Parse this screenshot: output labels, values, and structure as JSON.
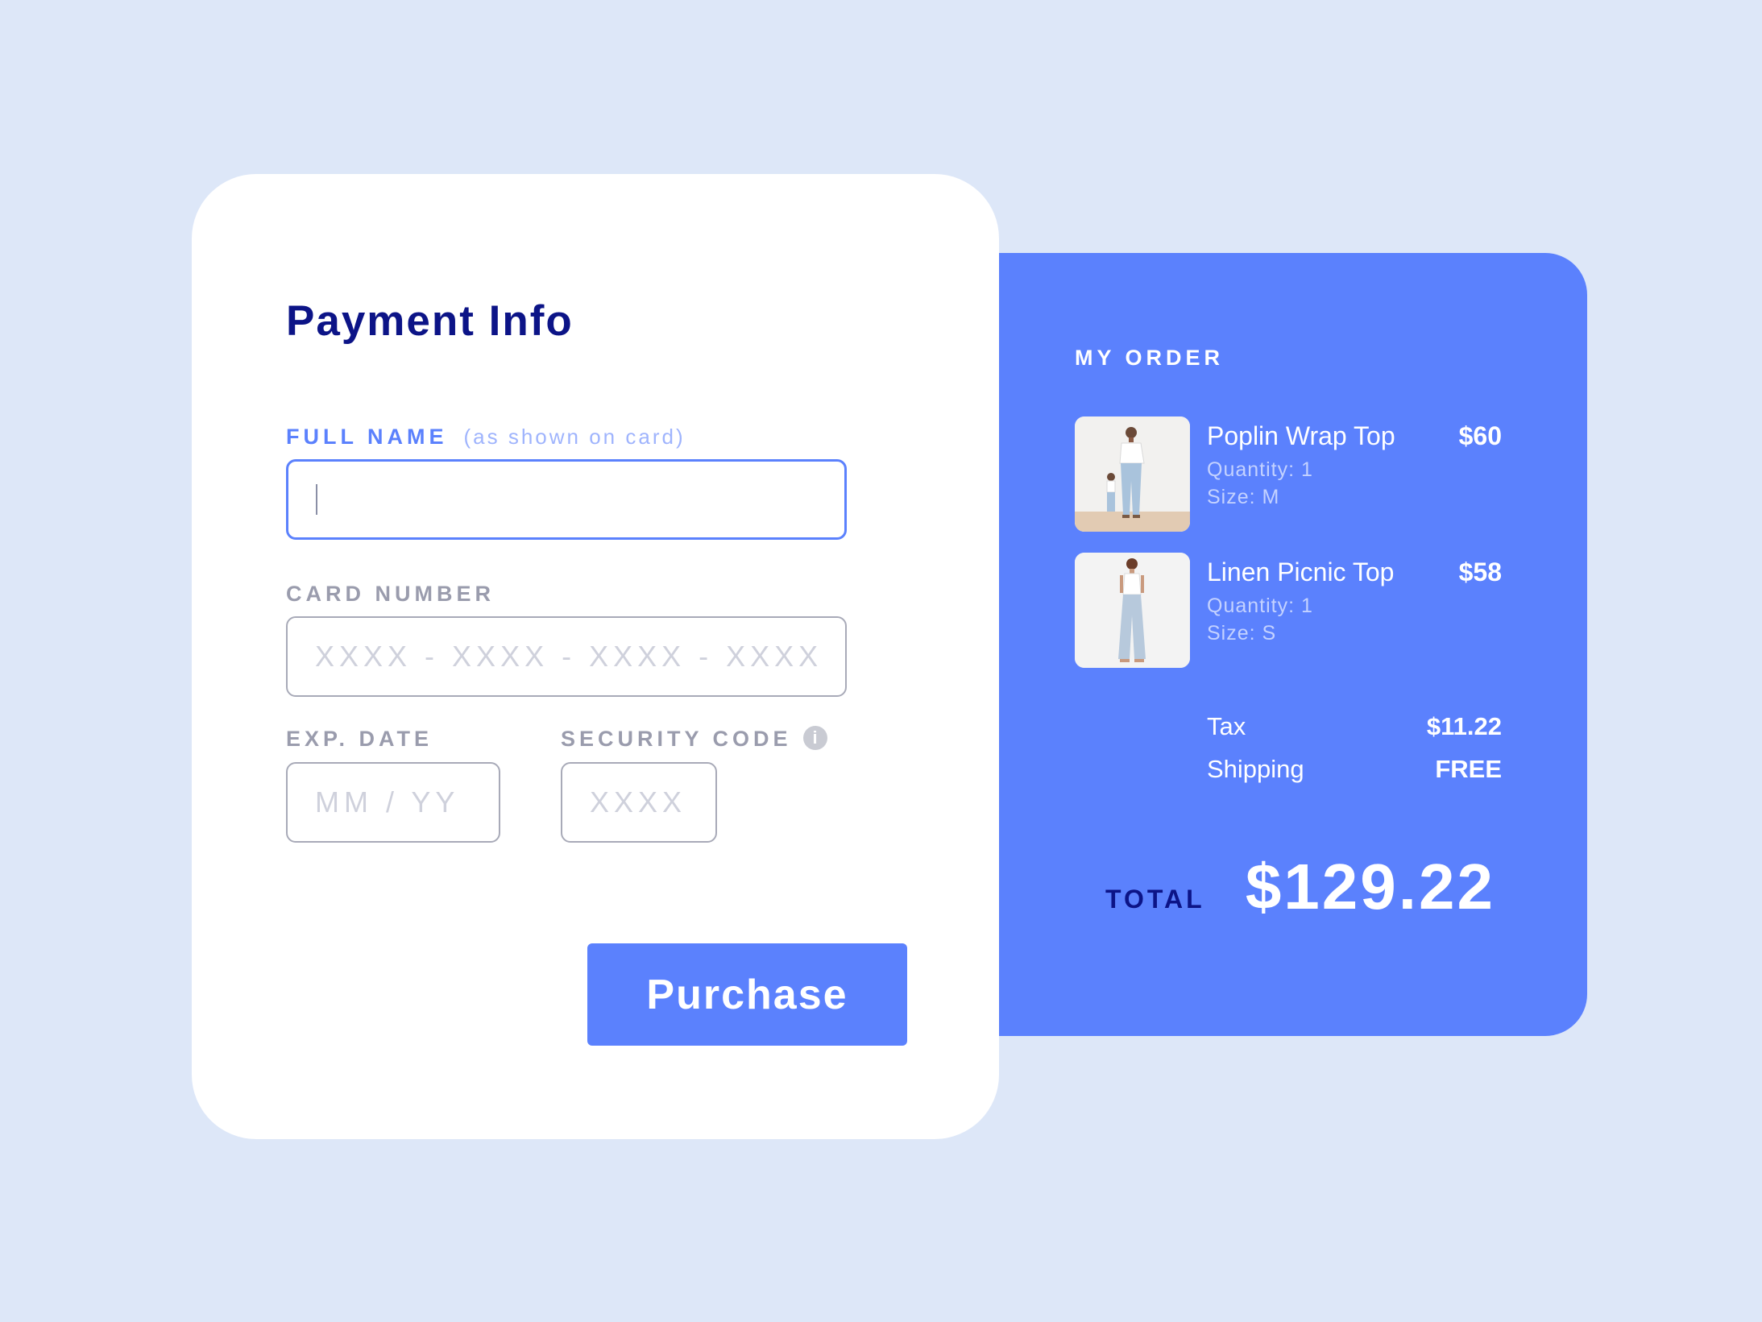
{
  "payment": {
    "title": "Payment Info",
    "full_name": {
      "label": "FULL NAME",
      "hint": "(as shown on card)",
      "value": "",
      "placeholder": ""
    },
    "card_number": {
      "label": "CARD NUMBER",
      "value": "",
      "placeholder": "XXXX - XXXX - XXXX - XXXX"
    },
    "exp_date": {
      "label": "EXP. DATE",
      "value": "",
      "placeholder": "MM / YY"
    },
    "security_code": {
      "label": "SECURITY CODE",
      "value": "",
      "placeholder": "XXXX",
      "info_icon": "info-icon"
    },
    "purchase_label": "Purchase"
  },
  "order": {
    "heading": "MY ORDER",
    "items": [
      {
        "name": "Poplin Wrap Top",
        "price": "$60",
        "quantity": "Quantity: 1",
        "size": "Size: M",
        "image": "product-photo-poplin-wrap-top"
      },
      {
        "name": "Linen Picnic Top",
        "price": "$58",
        "quantity": "Quantity: 1",
        "size": "Size: S",
        "image": "product-photo-linen-picnic-top"
      }
    ],
    "tax": {
      "label": "Tax",
      "value": "$11.22"
    },
    "shipping": {
      "label": "Shipping",
      "value": "FREE"
    },
    "total": {
      "label": "TOTAL",
      "value": "$129.22"
    }
  },
  "colors": {
    "background": "#dde7f8",
    "accent": "#5b81fd",
    "navy": "#0c1487",
    "card": "#ffffff"
  }
}
